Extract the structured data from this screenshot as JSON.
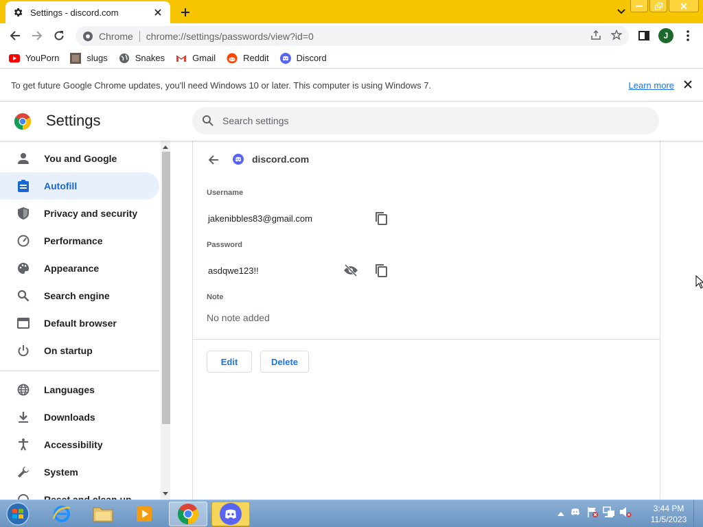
{
  "tab": {
    "title": "Settings - discord.com"
  },
  "omnibox": {
    "site_label": "Chrome",
    "url": "chrome://settings/passwords/view?id=0"
  },
  "profile": {
    "initial": "J",
    "color": "#1e6a2e"
  },
  "bookmarks": [
    {
      "label": "YouPorn",
      "icon": "youtube-style-icon"
    },
    {
      "label": "slugs",
      "icon": "image-thumb-icon"
    },
    {
      "label": "Snakes",
      "icon": "globe-icon"
    },
    {
      "label": "Gmail",
      "icon": "gmail-icon"
    },
    {
      "label": "Reddit",
      "icon": "reddit-icon"
    },
    {
      "label": "Discord",
      "icon": "discord-icon"
    }
  ],
  "infobar": {
    "message": "To get future Google Chrome updates, you'll need Windows 10 or later. This computer is using Windows 7.",
    "link": "Learn more"
  },
  "settings": {
    "title": "Settings",
    "search_placeholder": "Search settings"
  },
  "sidebar": {
    "items": [
      {
        "label": "You and Google",
        "icon": "person-icon"
      },
      {
        "label": "Autofill",
        "icon": "clipboard-icon",
        "active": true
      },
      {
        "label": "Privacy and security",
        "icon": "shield-icon"
      },
      {
        "label": "Performance",
        "icon": "speedometer-icon"
      },
      {
        "label": "Appearance",
        "icon": "palette-icon"
      },
      {
        "label": "Search engine",
        "icon": "search-icon"
      },
      {
        "label": "Default browser",
        "icon": "browser-icon"
      },
      {
        "label": "On startup",
        "icon": "power-icon"
      },
      {
        "label": "Languages",
        "icon": "globe-icon"
      },
      {
        "label": "Downloads",
        "icon": "download-icon"
      },
      {
        "label": "Accessibility",
        "icon": "accessibility-icon"
      },
      {
        "label": "System",
        "icon": "wrench-icon"
      },
      {
        "label": "Reset and clean up",
        "icon": "reset-icon"
      }
    ]
  },
  "password_detail": {
    "site": "discord.com",
    "username_label": "Username",
    "username": "jakenibbles83@gmail.com",
    "password_label": "Password",
    "password": "asdqwe123!!",
    "note_label": "Note",
    "note": "No note added",
    "edit_label": "Edit",
    "delete_label": "Delete"
  },
  "taskbar": {
    "time": "3:44 PM",
    "date": "11/5/2023"
  },
  "colors": {
    "accent": "#1a73e8",
    "active_nav_bg": "#e8f0fe",
    "tabstrip": "#f7c400",
    "discord": "#5865f2"
  }
}
